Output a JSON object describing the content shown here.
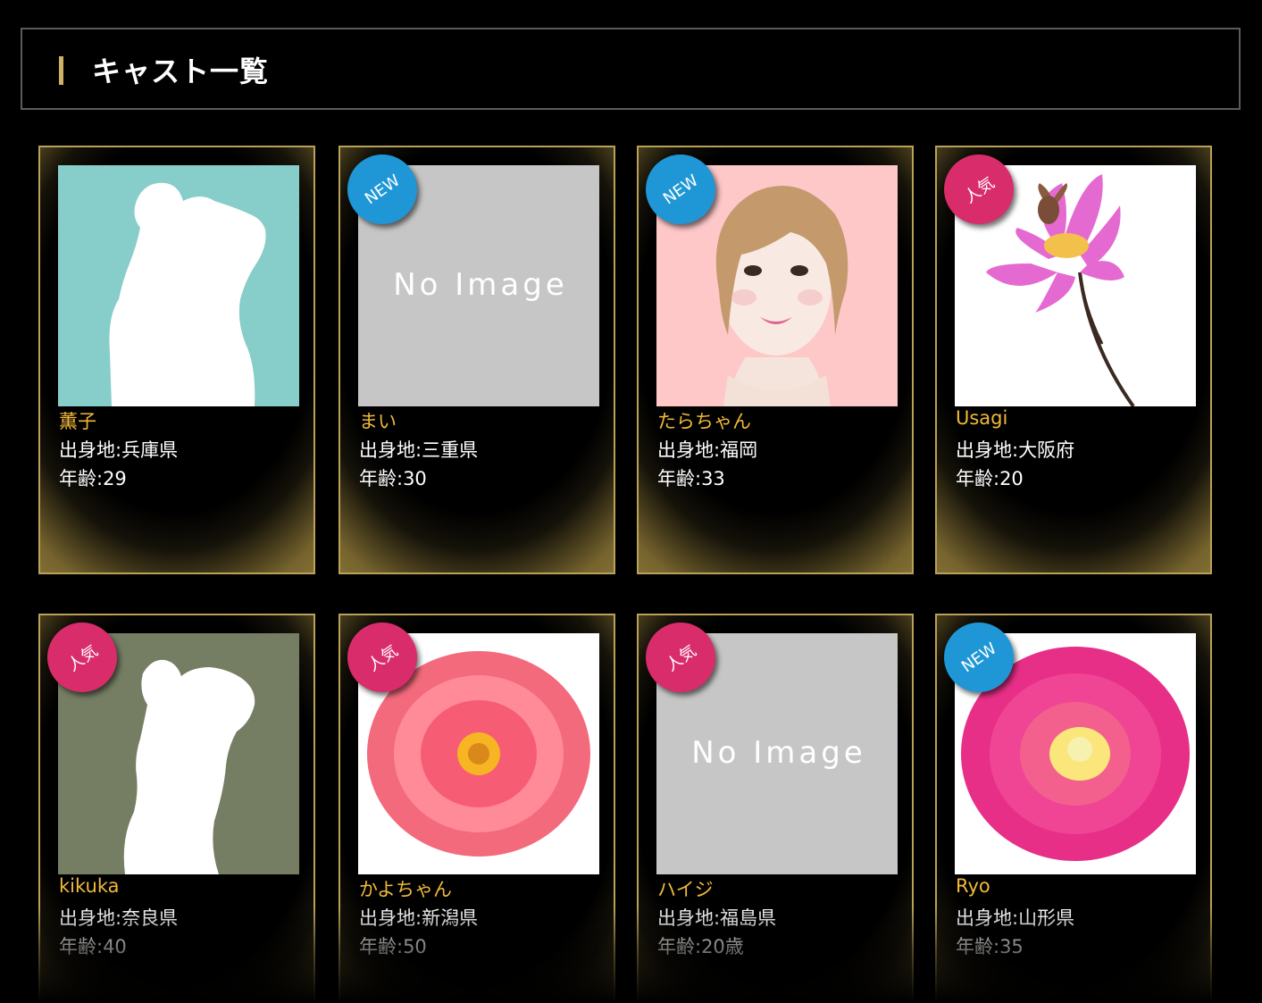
{
  "header": {
    "title": "キャスト一覧"
  },
  "colors": {
    "accent_gold": "#cfb16a",
    "name_color": "#f0b93a",
    "badge_new": "#1f97d6",
    "badge_popular": "#d92c6b"
  },
  "casts": [
    {
      "name": "薫子",
      "origin": "出身地:兵庫県",
      "age": "年齢:29",
      "badge": "",
      "image": "silhouette-teal"
    },
    {
      "name": "まい",
      "origin": "出身地:三重県",
      "age": "年齢:30",
      "badge": "NEW",
      "image": "no-image",
      "no_image_text": "No Image"
    },
    {
      "name": "たらちゃん",
      "origin": "出身地:福岡",
      "age": "年齢:33",
      "badge": "NEW",
      "image": "illustrated-face"
    },
    {
      "name": "Usagi",
      "origin": "出身地:大阪府",
      "age": "年齢:20",
      "badge": "人気",
      "image": "lotus-flower"
    },
    {
      "name": "kikuka",
      "origin": "出身地:奈良県",
      "age": "年齢:40",
      "badge": "人気",
      "image": "silhouette-olive"
    },
    {
      "name": "かよちゃん",
      "origin": "出身地:新潟県",
      "age": "年齢:50",
      "badge": "人気",
      "image": "dahlia-coral"
    },
    {
      "name": "ハイジ",
      "origin": "出身地:福島県",
      "age": "年齢:20歳",
      "badge": "人気",
      "image": "no-image",
      "no_image_text": "No Image"
    },
    {
      "name": "Ryo",
      "origin": "出身地:山形県",
      "age": "年齢:35",
      "badge": "NEW",
      "image": "dahlia-pink"
    }
  ]
}
